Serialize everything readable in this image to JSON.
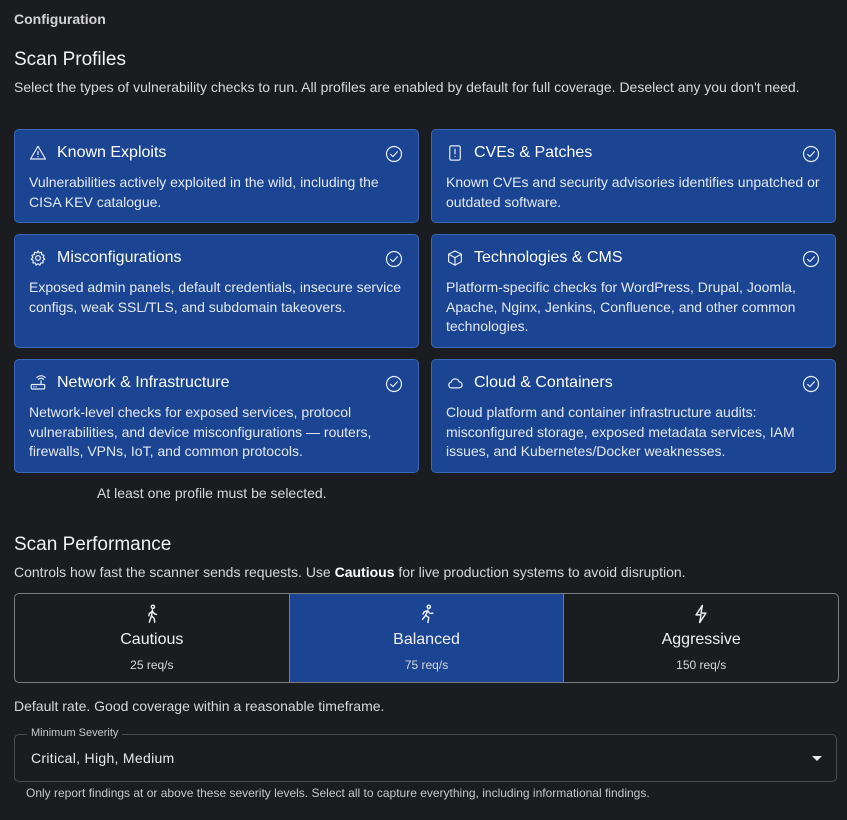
{
  "header": {
    "title": "Configuration"
  },
  "scan_profiles": {
    "title": "Scan Profiles",
    "description": "Select the types of vulnerability checks to run. All profiles are enabled by default for full coverage. Deselect any you don't need.",
    "cards": [
      {
        "icon": "warning-triangle-icon",
        "title": "Known Exploits",
        "description": "Vulnerabilities actively exploited in the wild, including the CISA KEV catalogue.",
        "selected": true
      },
      {
        "icon": "alert-document-icon",
        "title": "CVEs & Patches",
        "description": "Known CVEs and security advisories identifies unpatched or outdated software.",
        "selected": true
      },
      {
        "icon": "gear-icon",
        "title": "Misconfigurations",
        "description": "Exposed admin panels, default credentials, insecure service configs, weak SSL/TLS, and subdomain takeovers.",
        "selected": true
      },
      {
        "icon": "cube-icon",
        "title": "Technologies & CMS",
        "description": "Platform-specific checks for WordPress, Drupal, Joomla, Apache, Nginx, Jenkins, Confluence, and other common technologies.",
        "selected": true
      },
      {
        "icon": "router-icon",
        "title": "Network & Infrastructure",
        "description": "Network-level checks for exposed services, protocol vulnerabilities, and device misconfigurations — routers, firewalls, VPNs, IoT, and common protocols.",
        "selected": true
      },
      {
        "icon": "cloud-icon",
        "title": "Cloud & Containers",
        "description": "Cloud platform and container infrastructure audits: misconfigured storage, exposed metadata services, IAM issues, and Kubernetes/Docker weaknesses.",
        "selected": true
      }
    ],
    "hint": "At least one profile must be selected."
  },
  "scan_performance": {
    "title": "Scan Performance",
    "description_prefix": "Controls how fast the scanner sends requests. Use ",
    "description_bold": "Cautious",
    "description_suffix": " for live production systems to avoid disruption.",
    "options": [
      {
        "icon": "walking-person-icon",
        "label": "Cautious",
        "rate": "25 req/s",
        "selected": false
      },
      {
        "icon": "running-person-icon",
        "label": "Balanced",
        "rate": "75 req/s",
        "selected": true
      },
      {
        "icon": "lightning-bolt-icon",
        "label": "Aggressive",
        "rate": "150 req/s",
        "selected": false
      }
    ],
    "note": "Default rate. Good coverage within a reasonable timeframe."
  },
  "severity": {
    "label": "Minimum Severity",
    "value": "Critical, High, Medium",
    "help": "Only report findings at or above these severity levels. Select all to capture everything, including informational findings."
  },
  "colors": {
    "background": "#1b1c1f",
    "card_selected": "#1b4593",
    "card_border": "#3c67b5"
  }
}
